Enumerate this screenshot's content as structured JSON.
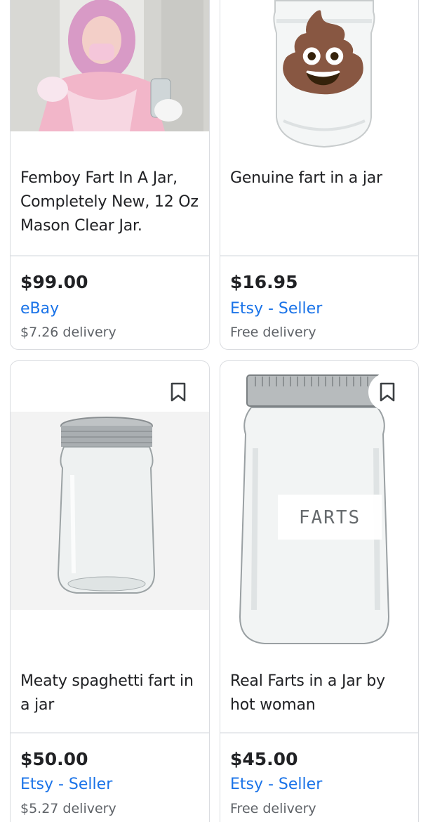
{
  "products": [
    {
      "title": "Femboy Fart In A Jar, Completely New, 12 Oz Mason Clear Jar.",
      "price": "$99.00",
      "seller": "eBay",
      "delivery": "$7.26 delivery"
    },
    {
      "title": "Genuine fart in a jar",
      "price": "$16.95",
      "seller": "Etsy - Seller",
      "delivery": "Free delivery",
      "image_emoji": "💩"
    },
    {
      "title": "Meaty spaghetti fart in a jar",
      "price": "$50.00",
      "seller": "Etsy - Seller",
      "delivery": "$5.27 delivery"
    },
    {
      "title": "Real Farts in a Jar by hot woman",
      "price": "$45.00",
      "seller": "Etsy - Seller",
      "delivery": "Free delivery",
      "jar_label": "FARTS"
    }
  ],
  "icons": {
    "bookmark": "bookmark-icon"
  },
  "colors": {
    "seller_link": "#1a73e8",
    "price": "#202124",
    "delivery": "#5f6368",
    "card_border": "#dadce0"
  }
}
